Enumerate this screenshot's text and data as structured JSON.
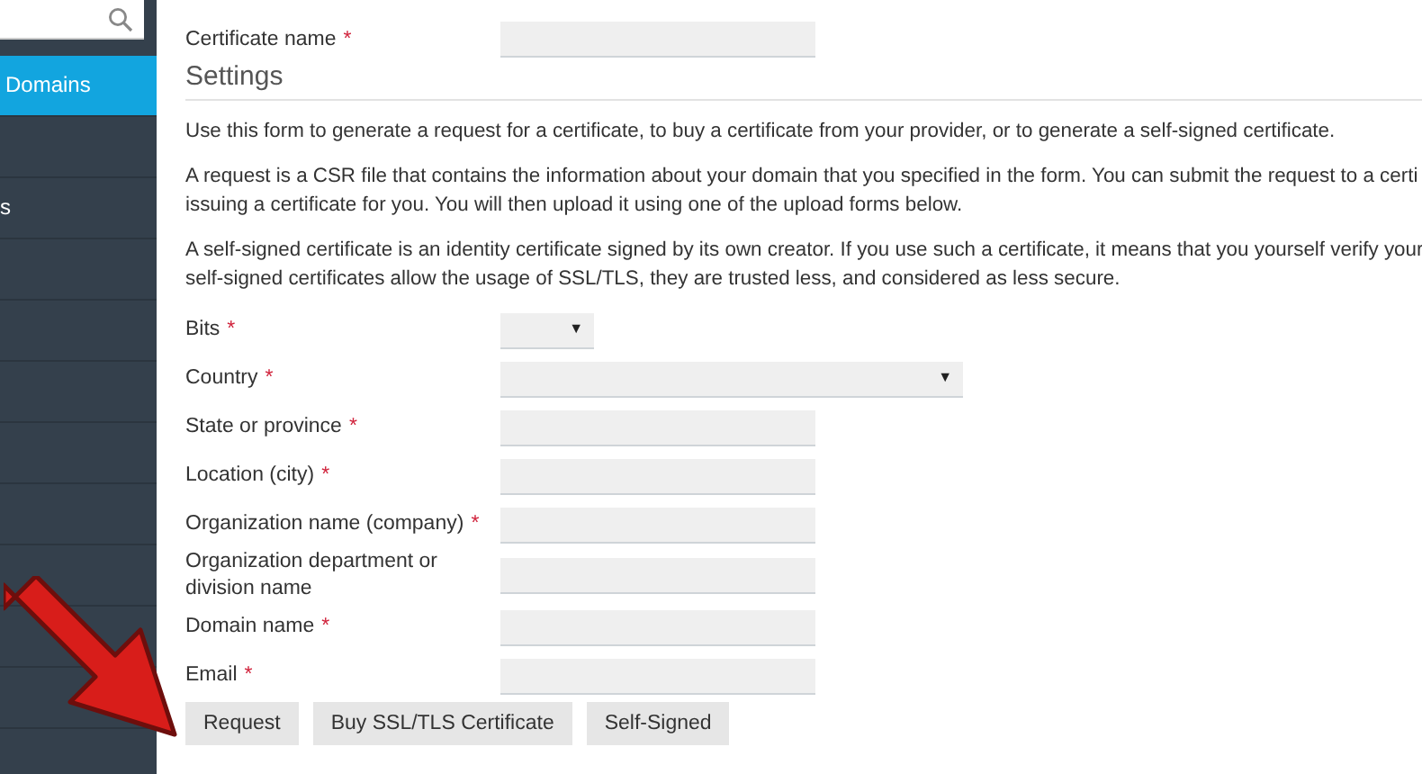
{
  "sidebar": {
    "items": [
      {
        "label": "Domains",
        "selected": true
      },
      {
        "label": "s",
        "selected": false
      }
    ]
  },
  "certificate_name": {
    "label": "Certificate name",
    "required": true
  },
  "required_mark": "*",
  "settings": {
    "title": "Settings",
    "paragraphs": [
      [
        "Use this form to generate a request for a certificate, to buy a certificate from your provider, or to generate a self-signed certificate."
      ],
      [
        "A request is a CSR file that contains the information about your domain that you specified in the form. You can submit the request to a certi",
        "issuing a certificate for you. You will then upload it using one of the upload forms below."
      ],
      [
        "A self-signed certificate is an identity certificate signed by its own creator. If you use such a certificate, it means that you yourself verify your",
        "self-signed certificates allow the usage of SSL/TLS, they are trusted less, and considered as less secure."
      ]
    ],
    "fields": [
      {
        "label": "Bits",
        "required": true,
        "kind": "short-select",
        "caret": "▼"
      },
      {
        "label": "Country",
        "required": true,
        "kind": "select",
        "caret": "▼"
      },
      {
        "label": "State or province",
        "required": true,
        "kind": "text"
      },
      {
        "label": "Location (city)",
        "required": true,
        "kind": "text"
      },
      {
        "label": "Organization name (company)",
        "required": true,
        "kind": "text"
      },
      {
        "label": "Organization department or division name",
        "required": false,
        "kind": "text"
      },
      {
        "label": "Domain name",
        "required": true,
        "kind": "text"
      },
      {
        "label": "Email",
        "required": true,
        "kind": "text"
      }
    ]
  },
  "buttons": [
    "Request",
    "Buy SSL/TLS Certificate",
    "Self-Signed"
  ]
}
